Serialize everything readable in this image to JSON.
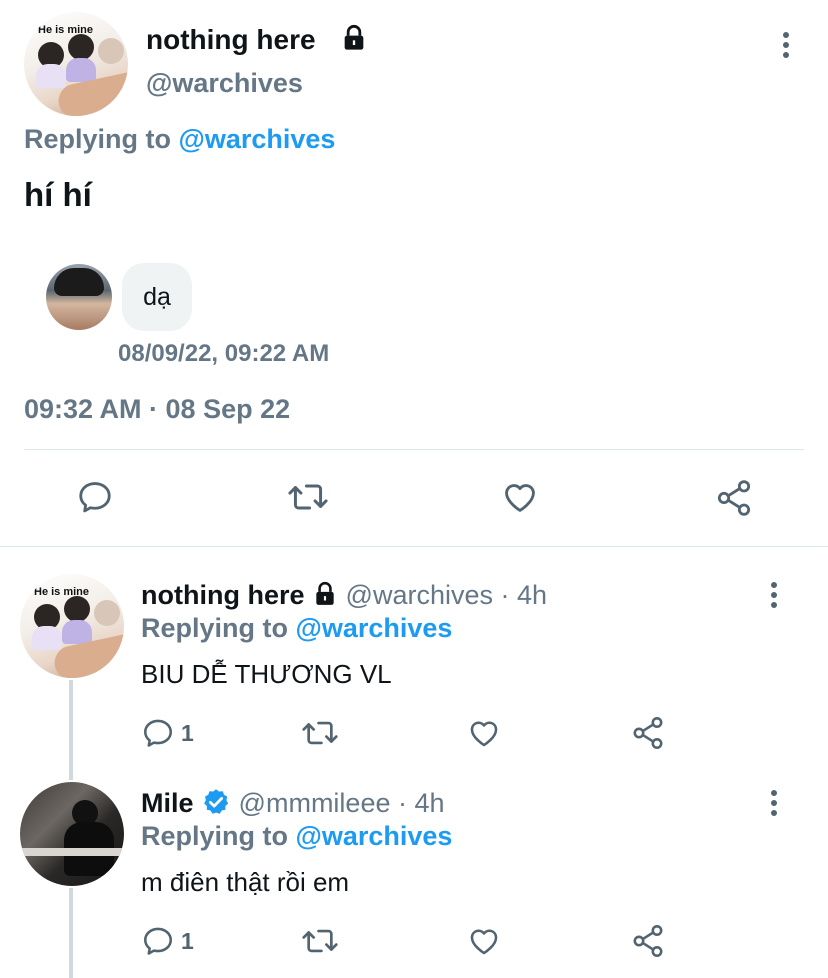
{
  "main_tweet": {
    "display_name": "nothing here",
    "handle": "@warchives",
    "replying_label": "Replying to",
    "replying_handle": "@warchives",
    "text": "hí hí",
    "avatar_text": "He is mine",
    "quoted_message": {
      "text": "dạ",
      "timestamp": "08/09/22, 09:22 AM"
    },
    "timestamp": "09:32 AM · 08 Sep 22",
    "icons": [
      "lock-icon",
      "more-icon",
      "reply-icon",
      "retweet-icon",
      "like-icon",
      "share-icon"
    ]
  },
  "replies": [
    {
      "display_name": "nothing here",
      "handle": "@warchives",
      "time": "· 4h",
      "replying_label": "Replying to",
      "replying_handle": "@warchives",
      "text": "BIU DỄ THƯƠNG VL",
      "reply_count": "1",
      "avatar_text": "He is mine"
    },
    {
      "display_name": "Mile",
      "handle": "@mmmileee",
      "time": "· 4h",
      "replying_label": "Replying to",
      "replying_handle": "@warchives",
      "text": "m điên thật rồi em",
      "reply_count": "1",
      "verified": true
    }
  ],
  "colors": {
    "accent": "#1d9bf0",
    "text": "#0f1419",
    "secondary": "#657786",
    "divider": "#e1e8ed",
    "bubble": "#eff3f4"
  }
}
